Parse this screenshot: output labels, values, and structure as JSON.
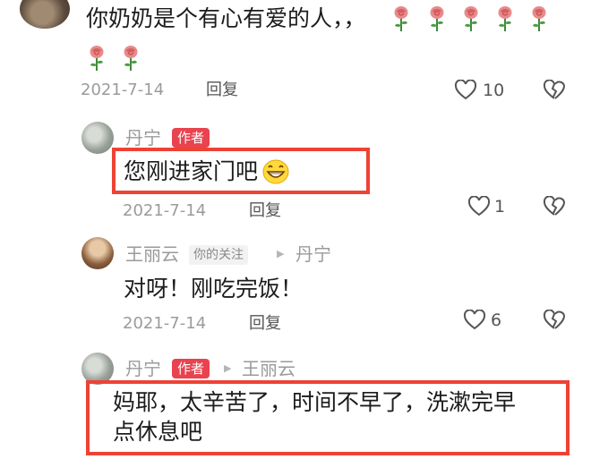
{
  "comment_top": {
    "text": "你奶奶是个有心有爱的人，，",
    "date": "2021-7-14",
    "reply_label": "回复",
    "like_count": "10"
  },
  "reply1": {
    "user": "丹宁",
    "badge": "作者",
    "text": "您刚进家门吧",
    "date": "2021-7-14",
    "reply_label": "回复",
    "like_count": "1"
  },
  "reply2": {
    "user": "王丽云",
    "follow_label": "你的关注",
    "reply_to": "丹宁",
    "text": "对呀！刚吃完饭！",
    "date": "2021-7-14",
    "reply_label": "回复",
    "like_count": "6"
  },
  "reply3": {
    "user": "丹宁",
    "badge": "作者",
    "reply_to": "王丽云",
    "text_line1": "妈耶，太辛苦了，时间不早了，洗漱完早",
    "text_line2": "点休息吧"
  },
  "colors": {
    "badge": "#e9434f",
    "highlight_box": "#ee4235",
    "meta": "#9b9b9b"
  },
  "icons": [
    "rose-emoji",
    "grin-emoji",
    "heart-outline-icon",
    "broken-heart-icon",
    "triangle-right-icon"
  ]
}
